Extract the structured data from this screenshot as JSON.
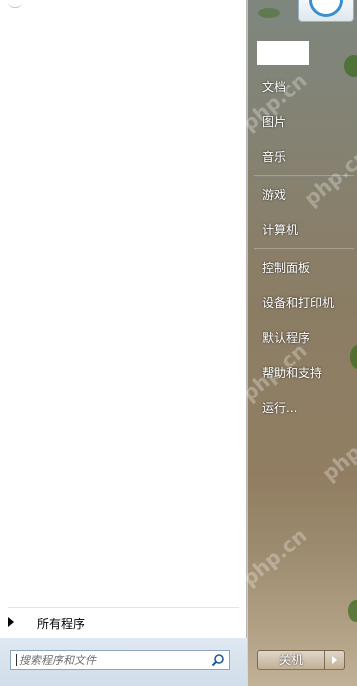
{
  "left_pane": {
    "all_programs_label": "所有程序",
    "search": {
      "placeholder": "搜索程序和文件",
      "icon": "search-icon"
    }
  },
  "right_pane": {
    "items": [
      {
        "label": "文档"
      },
      {
        "label": "图片"
      },
      {
        "label": "音乐"
      },
      {
        "label": "游戏"
      },
      {
        "label": "计算机"
      },
      {
        "label": "控制面板"
      },
      {
        "label": "设备和打印机"
      },
      {
        "label": "默认程序"
      },
      {
        "label": "帮助和支持"
      },
      {
        "label": "运行..."
      }
    ],
    "shutdown_label": "关机",
    "watermark": "php.cn"
  },
  "colors": {
    "accent": "#3a8fd1",
    "left_bg": "#ffffff",
    "search_band": "#d9e3ee"
  }
}
